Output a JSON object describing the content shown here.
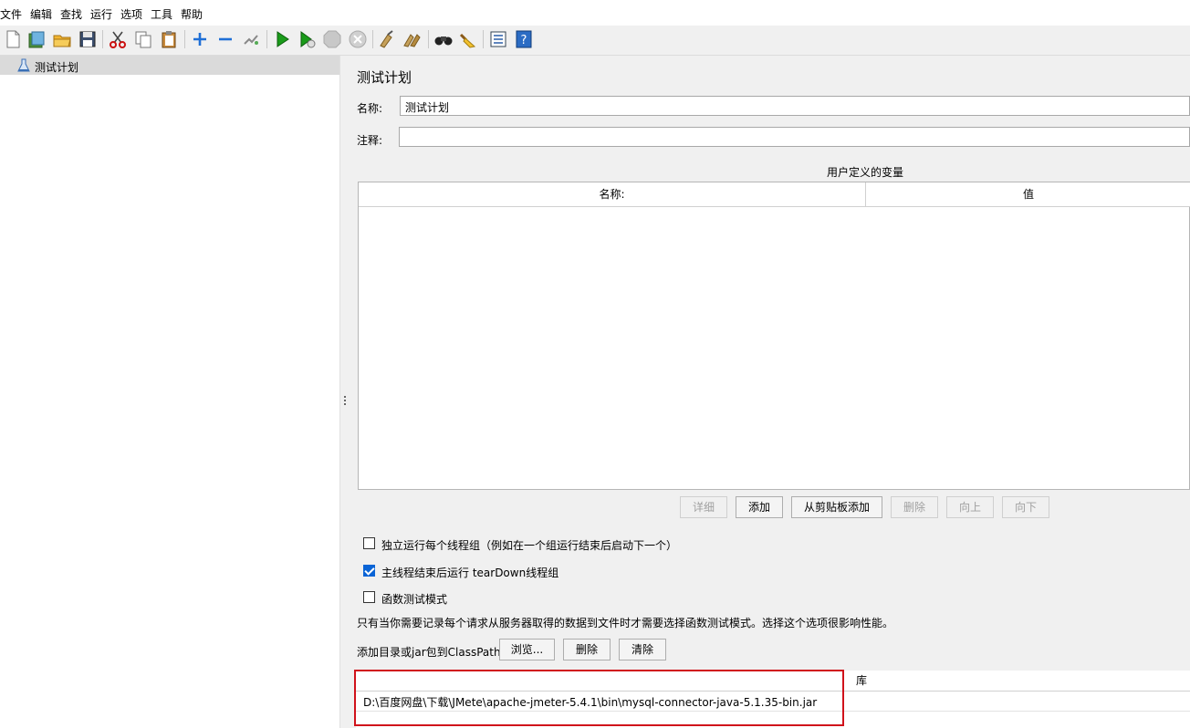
{
  "menu": [
    "文件",
    "编辑",
    "查找",
    "运行",
    "选项",
    "工具",
    "帮助"
  ],
  "toolbar": {
    "icons": [
      "new-icon",
      "templates-icon",
      "open-icon",
      "save-icon",
      "cut-icon",
      "copy-icon",
      "paste-icon",
      "expand-icon",
      "collapse-icon",
      "toggle-icon",
      "start-icon",
      "start-no-pause-icon",
      "stop-icon",
      "shutdown-icon",
      "clear-icon",
      "clear-all-icon",
      "search-icon",
      "reset-search-icon",
      "function-helper-icon",
      "help-icon"
    ],
    "colors": {
      "play": "#1a9b1a",
      "plus": "#1f6fd6",
      "stop": "#c8c8c8"
    }
  },
  "tree": {
    "items": [
      {
        "label": "测试计划"
      }
    ]
  },
  "panel": {
    "title": "测试计划",
    "name_label": "名称:",
    "name_value": "测试计划",
    "comment_label": "注释:",
    "comment_value": "",
    "variables": {
      "title": "用户定义的变量",
      "columns": [
        "名称:",
        "值"
      ],
      "rows": [],
      "buttons": [
        {
          "label": "详细",
          "enabled": false
        },
        {
          "label": "添加",
          "enabled": true
        },
        {
          "label": "从剪贴板添加",
          "enabled": true
        },
        {
          "label": "删除",
          "enabled": false
        },
        {
          "label": "向上",
          "enabled": false
        },
        {
          "label": "向下",
          "enabled": false
        }
      ]
    },
    "options": [
      {
        "label": "独立运行每个线程组（例如在一个组运行结束后启动下一个）",
        "checked": false
      },
      {
        "label": "主线程结束后运行 tearDown线程组",
        "checked": true
      },
      {
        "label": "函数测试模式",
        "checked": false
      }
    ],
    "note": "只有当你需要记录每个请求从服务器取得的数据到文件时才需要选择函数测试模式。选择这个选项很影响性能。",
    "classpath": {
      "label": "添加目录或jar包到ClassPath",
      "browse": "浏览...",
      "delete": "删除",
      "clear": "清除",
      "column": "库",
      "rows": [
        "D:\\百度网盘\\下载\\JMete\\apache-jmeter-5.4.1\\bin\\mysql-connector-java-5.1.35-bin.jar"
      ]
    },
    "highlight_color": "#d0121b"
  }
}
